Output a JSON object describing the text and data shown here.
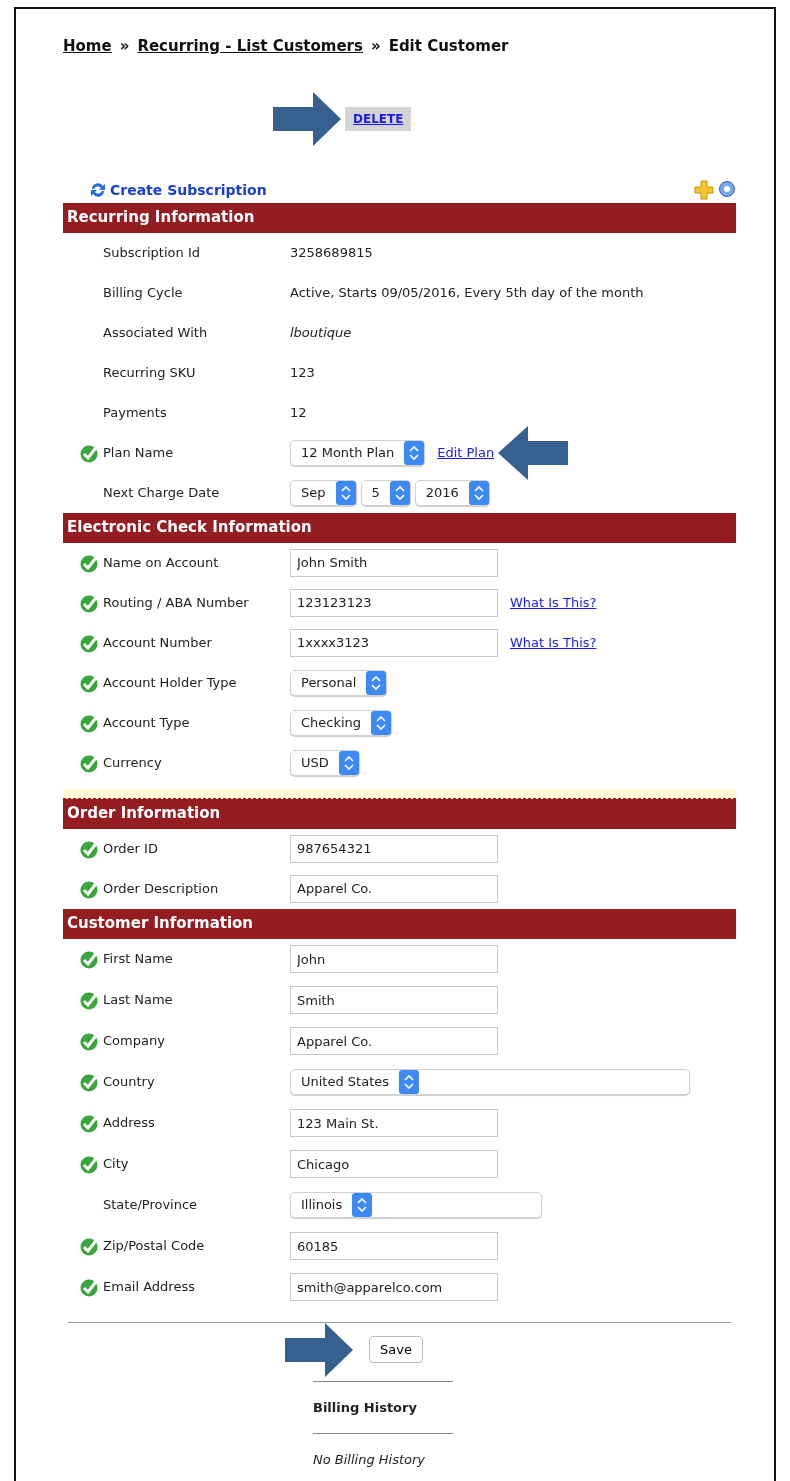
{
  "breadcrumb": [
    {
      "kind": "link",
      "text": "Home"
    },
    {
      "kind": "sep",
      "text": "»"
    },
    {
      "kind": "link",
      "text": "Recurring - List Customers"
    },
    {
      "kind": "sep",
      "text": "»"
    },
    {
      "kind": "current",
      "text": "Edit Customer"
    }
  ],
  "delete_link": "DELETE",
  "create_subscription": "Create Subscription",
  "sections": [
    {
      "title": "Recurring Information",
      "rows": [
        {
          "label": "Subscription Id",
          "valid": false,
          "kind": "text",
          "value": "3258689815"
        },
        {
          "label": "Billing Cycle",
          "valid": false,
          "kind": "text",
          "value": "Active, Starts 09/05/2016, Every 5th day of the month"
        },
        {
          "label": "Associated With",
          "valid": false,
          "kind": "em",
          "value": "lboutique"
        },
        {
          "label": "Recurring SKU",
          "valid": false,
          "kind": "text",
          "value": "123"
        },
        {
          "label": "Payments",
          "valid": false,
          "kind": "text",
          "value": "12"
        },
        {
          "label": "Plan Name",
          "valid": true,
          "kind": "select",
          "values": [
            "12 Month Plan"
          ],
          "link": "Edit Plan"
        },
        {
          "label": "Next Charge Date",
          "valid": false,
          "kind": "select",
          "values": [
            "Sep",
            "5",
            "2016"
          ]
        }
      ]
    },
    {
      "title": "Electronic Check Information",
      "rows": [
        {
          "label": "Name on Account",
          "valid": true,
          "kind": "input",
          "value": "John Smith"
        },
        {
          "label": "Routing / ABA Number",
          "valid": true,
          "kind": "input",
          "value": "123123123",
          "link": "What Is This?"
        },
        {
          "label": "Account Number",
          "valid": true,
          "kind": "input",
          "value": "1xxxx3123",
          "link": "What Is This?"
        },
        {
          "label": "Account Holder Type",
          "valid": true,
          "kind": "select",
          "values": [
            "Personal"
          ]
        },
        {
          "label": "Account Type",
          "valid": true,
          "kind": "select",
          "values": [
            "Checking"
          ]
        },
        {
          "label": "Currency",
          "valid": true,
          "kind": "select",
          "values": [
            "USD"
          ]
        }
      ]
    },
    {
      "title": "Order Information",
      "rows": [
        {
          "label": "Order ID",
          "valid": true,
          "kind": "input",
          "value": "987654321"
        },
        {
          "label": "Order Description",
          "valid": true,
          "kind": "input",
          "value": "Apparel Co."
        }
      ]
    },
    {
      "title": "Customer Information",
      "rows": [
        {
          "label": "First Name",
          "valid": true,
          "kind": "input",
          "value": "John"
        },
        {
          "label": "Last Name",
          "valid": true,
          "kind": "input",
          "value": "Smith"
        },
        {
          "label": "Company",
          "valid": true,
          "kind": "input",
          "value": "Apparel Co."
        },
        {
          "label": "Country",
          "valid": true,
          "kind": "long_select",
          "values": [
            "United States"
          ]
        },
        {
          "label": "Address",
          "valid": true,
          "kind": "input",
          "value": "123 Main St."
        },
        {
          "label": "City",
          "valid": true,
          "kind": "input",
          "value": "Chicago"
        },
        {
          "label": "State/Province",
          "valid": false,
          "kind": "mid_select",
          "values": [
            "Illinois"
          ]
        },
        {
          "label": "Zip/Postal Code",
          "valid": true,
          "kind": "input",
          "value": "60185"
        },
        {
          "label": "Email Address",
          "valid": true,
          "kind": "input",
          "value": "smith@apparelco.com"
        }
      ]
    }
  ],
  "save_button": "Save",
  "billing_history": {
    "title": "Billing History",
    "empty": "No Billing History"
  }
}
